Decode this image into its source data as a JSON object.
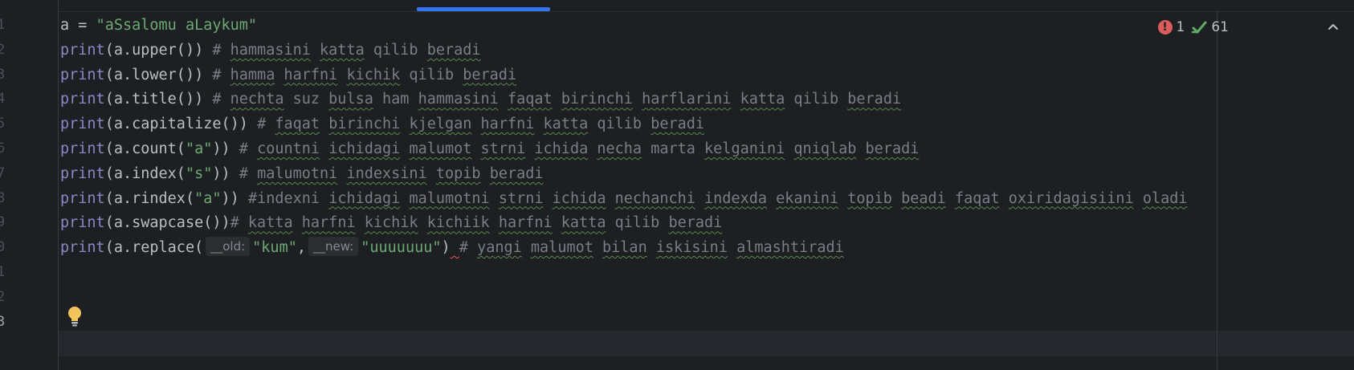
{
  "editor": {
    "status": {
      "errors": "1",
      "checks": "61"
    },
    "line_numbers": [
      "1",
      "2",
      "3",
      "4",
      "5",
      "6",
      "7",
      "8",
      "9",
      "0",
      "1",
      "2",
      "3"
    ],
    "hints": {
      "old": "__old:",
      "new": "__new:"
    },
    "lines": [
      {
        "t": [
          [
            "n",
            "a = "
          ],
          [
            "s",
            "\"aSsalomu aLaykum\""
          ]
        ]
      },
      {
        "t": [
          [
            "k",
            "print"
          ],
          [
            "n",
            "(a.upper()) "
          ],
          [
            "c",
            "# "
          ],
          [
            "cs",
            "hammasini"
          ],
          [
            "c",
            " "
          ],
          [
            "cs",
            "katta"
          ],
          [
            "c",
            " qilib "
          ],
          [
            "cs",
            "beradi"
          ]
        ]
      },
      {
        "t": [
          [
            "k",
            "print"
          ],
          [
            "n",
            "(a.lower()) "
          ],
          [
            "c",
            "# "
          ],
          [
            "cs",
            "hamma"
          ],
          [
            "c",
            " "
          ],
          [
            "cs",
            "harfni"
          ],
          [
            "c",
            " "
          ],
          [
            "cs",
            "kichik"
          ],
          [
            "c",
            " qilib "
          ],
          [
            "cs",
            "beradi"
          ]
        ]
      },
      {
        "t": [
          [
            "k",
            "print"
          ],
          [
            "n",
            "(a.title()) "
          ],
          [
            "c",
            "# "
          ],
          [
            "cs",
            "nechta"
          ],
          [
            "c",
            " suz "
          ],
          [
            "cs",
            "bulsa"
          ],
          [
            "c",
            " ham "
          ],
          [
            "cs",
            "hammasini"
          ],
          [
            "c",
            " "
          ],
          [
            "cs",
            "faqat"
          ],
          [
            "c",
            " "
          ],
          [
            "cs",
            "birinchi"
          ],
          [
            "c",
            " "
          ],
          [
            "cs",
            "harflarini"
          ],
          [
            "c",
            " "
          ],
          [
            "cs",
            "katta"
          ],
          [
            "c",
            " qilib "
          ],
          [
            "cs",
            "beradi"
          ]
        ]
      },
      {
        "t": [
          [
            "k",
            "print"
          ],
          [
            "n",
            "(a.capitalize()) "
          ],
          [
            "c",
            "# "
          ],
          [
            "cs",
            "faqat"
          ],
          [
            "c",
            " "
          ],
          [
            "cs",
            "birinchi"
          ],
          [
            "c",
            " "
          ],
          [
            "cs",
            "kjelgan"
          ],
          [
            "c",
            " "
          ],
          [
            "cs",
            "harfni"
          ],
          [
            "c",
            " "
          ],
          [
            "cs",
            "katta"
          ],
          [
            "c",
            " qilib "
          ],
          [
            "cs",
            "beradi"
          ]
        ]
      },
      {
        "t": [
          [
            "k",
            "print"
          ],
          [
            "n",
            "(a.count("
          ],
          [
            "s",
            "\"a\""
          ],
          [
            "n",
            ")) "
          ],
          [
            "c",
            "# "
          ],
          [
            "cs",
            "countni"
          ],
          [
            "c",
            " "
          ],
          [
            "cs",
            "ichidagi"
          ],
          [
            "c",
            " "
          ],
          [
            "cs",
            "malumot"
          ],
          [
            "c",
            " "
          ],
          [
            "cs",
            "strni"
          ],
          [
            "c",
            " "
          ],
          [
            "cs",
            "ichida"
          ],
          [
            "c",
            " "
          ],
          [
            "cs",
            "necha"
          ],
          [
            "c",
            " marta "
          ],
          [
            "cs",
            "kelganini"
          ],
          [
            "c",
            " "
          ],
          [
            "cs",
            "qniqlab"
          ],
          [
            "c",
            " "
          ],
          [
            "cs",
            "beradi"
          ]
        ]
      },
      {
        "t": [
          [
            "k",
            "print"
          ],
          [
            "n",
            "(a.index("
          ],
          [
            "s",
            "\"s\""
          ],
          [
            "n",
            ")) "
          ],
          [
            "c",
            "# "
          ],
          [
            "cs",
            "malumotni"
          ],
          [
            "c",
            " "
          ],
          [
            "cs",
            "indexsini"
          ],
          [
            "c",
            " "
          ],
          [
            "cs",
            "topib"
          ],
          [
            "c",
            " "
          ],
          [
            "cs",
            "beradi"
          ]
        ]
      },
      {
        "t": [
          [
            "k",
            "print"
          ],
          [
            "n",
            "(a.rindex("
          ],
          [
            "s",
            "\"a\""
          ],
          [
            "n",
            ")) "
          ],
          [
            "c",
            "#indexni "
          ],
          [
            "cs",
            "ichidagi"
          ],
          [
            "c",
            " "
          ],
          [
            "cs",
            "malumotni"
          ],
          [
            "c",
            " "
          ],
          [
            "cs",
            "strni"
          ],
          [
            "c",
            " "
          ],
          [
            "cs",
            "ichida"
          ],
          [
            "c",
            " "
          ],
          [
            "cs",
            "nechanchi"
          ],
          [
            "c",
            " "
          ],
          [
            "cs",
            "indexda"
          ],
          [
            "c",
            " "
          ],
          [
            "cs",
            "ekanini"
          ],
          [
            "c",
            " "
          ],
          [
            "cs",
            "topib"
          ],
          [
            "c",
            " "
          ],
          [
            "cs",
            "beadi"
          ],
          [
            "c",
            " "
          ],
          [
            "cs",
            "faqat"
          ],
          [
            "c",
            " "
          ],
          [
            "cs",
            "oxiridagisiini"
          ],
          [
            "c",
            " "
          ],
          [
            "cs",
            "oladi"
          ]
        ]
      },
      {
        "t": [
          [
            "k",
            "print"
          ],
          [
            "n",
            "(a.swapcase())"
          ],
          [
            "c",
            "# "
          ],
          [
            "cs",
            "katta"
          ],
          [
            "c",
            " "
          ],
          [
            "cs",
            "harfni"
          ],
          [
            "c",
            " "
          ],
          [
            "cs",
            "kichik"
          ],
          [
            "c",
            " "
          ],
          [
            "cs",
            "kichiik"
          ],
          [
            "c",
            " "
          ],
          [
            "cs",
            "harfni"
          ],
          [
            "c",
            " "
          ],
          [
            "cs",
            "katta"
          ],
          [
            "c",
            " qilib "
          ],
          [
            "cs",
            "beradi"
          ]
        ]
      },
      {
        "t": [
          [
            "k",
            "print"
          ],
          [
            "n",
            "(a.replace("
          ],
          [
            "h",
            "old"
          ],
          [
            "s",
            "\"kum\""
          ],
          [
            "n",
            ","
          ],
          [
            "h",
            "new"
          ],
          [
            "s",
            "\"uuuuuuu\""
          ],
          [
            "n",
            ")"
          ],
          [
            "e",
            " "
          ],
          [
            "c",
            "# "
          ],
          [
            "cs",
            "yangi"
          ],
          [
            "c",
            " "
          ],
          [
            "cs",
            "malumot"
          ],
          [
            "c",
            " "
          ],
          [
            "cs",
            "bilan"
          ],
          [
            "c",
            " "
          ],
          [
            "cs",
            "iskisini"
          ],
          [
            "c",
            " "
          ],
          [
            "cs",
            "almashtiradi"
          ]
        ]
      }
    ]
  }
}
